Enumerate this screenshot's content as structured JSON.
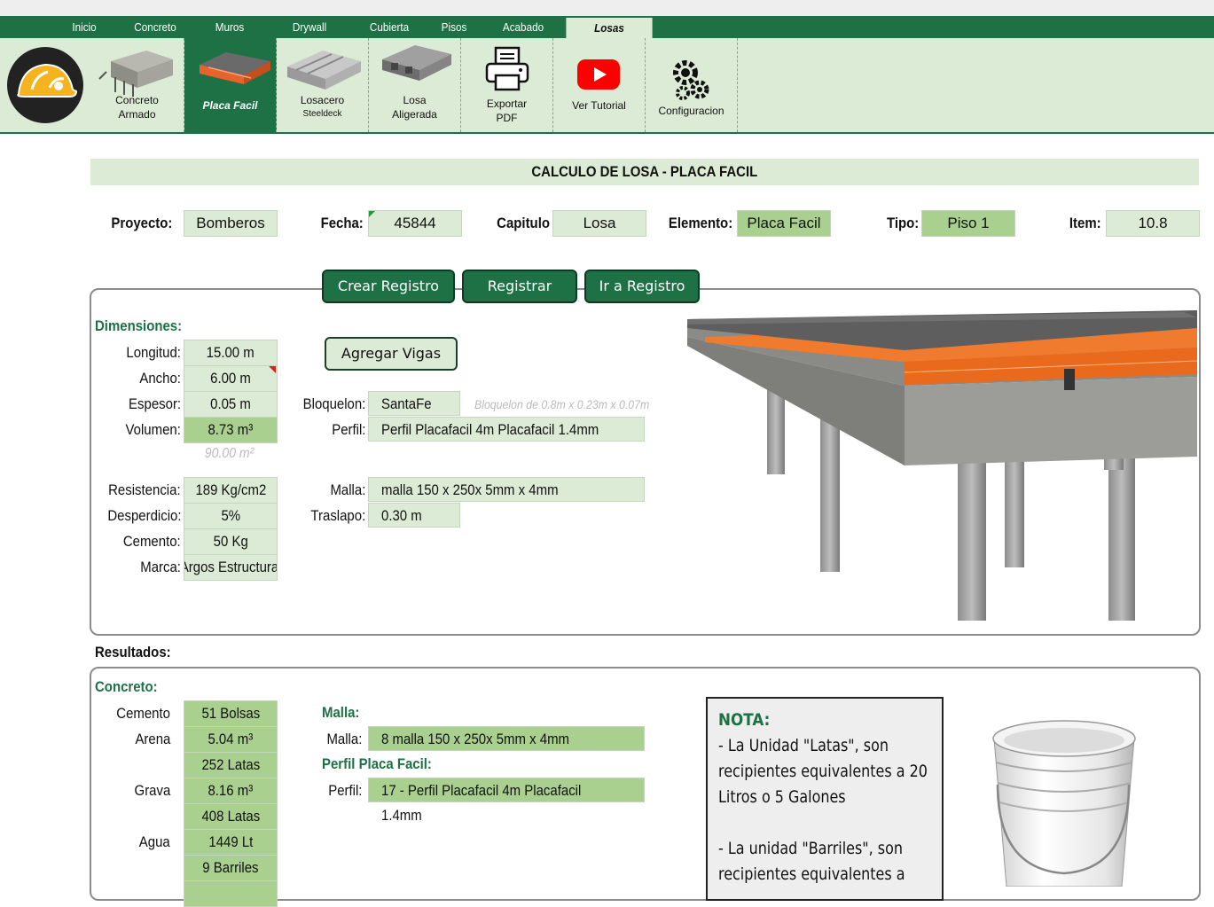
{
  "tabs": [
    "Inicio",
    "Concreto",
    "Muros",
    "Drywall",
    "Cubierta",
    "Pisos",
    "Acabado",
    "Losas"
  ],
  "ribbon": {
    "concreto_armado": "Concreto\nArmado",
    "placa_facil": "Placa Facil",
    "losacero": "Losacero",
    "steeldeck": "Steeldeck",
    "losa_aligerada": "Losa\nAligerada",
    "exportar_pdf": "Exportar\nPDF",
    "ver_tutorial": "Ver Tutorial",
    "configuracion": "Configuracion"
  },
  "title": "CALCULO DE LOSA - PLACA FACIL",
  "header": {
    "proyecto_label": "Proyecto:",
    "proyecto": "Bomberos",
    "fecha_label": "Fecha:",
    "fecha": "45844",
    "capitulo_label": "Capitulo",
    "capitulo": "Losa",
    "elemento_label": "Elemento:",
    "elemento": "Placa Facil",
    "tipo_label": "Tipo:",
    "tipo": "Piso 1",
    "item_label": "Item:",
    "item": "10.8"
  },
  "buttons": {
    "crear": "Crear Registro",
    "registrar": "Registrar",
    "ir": "Ir a Registro",
    "agregar_vigas": "Agregar Vigas"
  },
  "dimensiones": {
    "title": "Dimensiones:",
    "longitud_label": "Longitud:",
    "longitud": "15.00 m",
    "ancho_label": "Ancho:",
    "ancho": "6.00 m",
    "espesor_label": "Espesor:",
    "espesor": "0.05 m",
    "volumen_label": "Volumen:",
    "volumen": "8.73 m³",
    "area": "90.00 m²",
    "resistencia_label": "Resistencia:",
    "resistencia": "189 Kg/cm2",
    "desperdicio_label": "Desperdicio:",
    "desperdicio": "5%",
    "cemento_label": "Cemento:",
    "cemento": "50 Kg",
    "marca_label": "Marca:",
    "marca": "Argos Estructural",
    "bloquelon_label": "Bloquelon:",
    "bloquelon": "SantaFe",
    "bloquelon_hint": "Bloquelon de 0.8m x 0.23m x 0.07m",
    "perfil_label": "Perfil:",
    "perfil": "Perfil Placafacil 4m Placafacil 1.4mm",
    "malla_label": "Malla:",
    "malla": "malla 150 x 250x 5mm x 4mm",
    "traslapo_label": "Traslapo:",
    "traslapo": "0.30 m"
  },
  "resultados": {
    "title": "Resultados:",
    "concreto_title": "Concreto:",
    "cemento_label": "Cemento",
    "cemento": "51 Bolsas",
    "arena_label": "Arena",
    "arena": "5.04 m³",
    "arena_latas": "252 Latas",
    "grava_label": "Grava",
    "grava": "8.16 m³",
    "grava_latas": "408 Latas",
    "agua_label": "Agua",
    "agua": "1449 Lt",
    "agua_barriles": "9 Barriles",
    "malla_title": "Malla:",
    "malla_label": "Malla:",
    "malla": "8 malla 150 x 250x 5mm x 4mm",
    "perfil_title": "Perfil Placa Facil:",
    "perfil_label": "Perfil:",
    "perfil": "17 - Perfil Placafacil 4m Placafacil 1.4mm"
  },
  "nota": {
    "title": "NOTA:",
    "line1": "- La Unidad \"Latas\", son recipientes equivalentes a 20 Litros o 5 Galones",
    "line2": "- La unidad \"Barriles\", son recipientes equivalentes a"
  }
}
